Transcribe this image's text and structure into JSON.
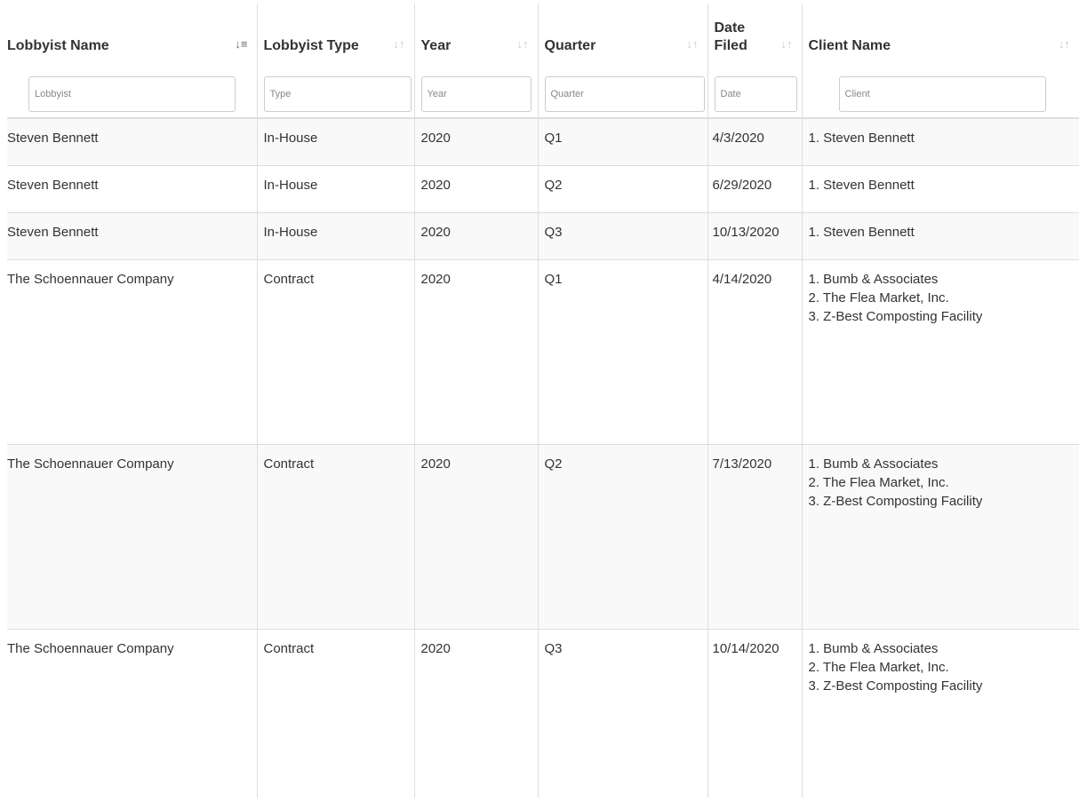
{
  "columns": [
    {
      "label": "Lobbyist Name",
      "filter_placeholder": "Lobbyist",
      "sort": "ascending"
    },
    {
      "label": "Lobbyist Type",
      "filter_placeholder": "Type",
      "sort": "none"
    },
    {
      "label": "Year",
      "filter_placeholder": "Year",
      "sort": "none"
    },
    {
      "label": "Quarter",
      "filter_placeholder": "Quarter",
      "sort": "none"
    },
    {
      "label_line1": "Date",
      "label_line2": "Filed",
      "filter_placeholder": "Date",
      "sort": "none"
    },
    {
      "label": "Client Name",
      "filter_placeholder": "Client",
      "sort": "none"
    }
  ],
  "sort_icons": {
    "active": "↓≡",
    "inactive": "↓↑"
  },
  "rows": [
    {
      "lobbyist": "Steven Bennett",
      "type": "In-House",
      "year": "2020",
      "quarter": "Q1",
      "date": "4/3/2020",
      "clients": [
        "1. Steven Bennett"
      ]
    },
    {
      "lobbyist": "Steven Bennett",
      "type": "In-House",
      "year": "2020",
      "quarter": "Q2",
      "date": "6/29/2020",
      "clients": [
        "1. Steven Bennett"
      ]
    },
    {
      "lobbyist": "Steven Bennett",
      "type": "In-House",
      "year": "2020",
      "quarter": "Q3",
      "date": "10/13/2020",
      "clients": [
        "1. Steven Bennett"
      ]
    },
    {
      "lobbyist": "The Schoennauer Company",
      "type": "Contract",
      "year": "2020",
      "quarter": "Q1",
      "date": "4/14/2020",
      "clients": [
        "1. Bumb & Associates",
        "2. The Flea Market, Inc.",
        "3. Z-Best Composting Facility"
      ]
    },
    {
      "lobbyist": "The Schoennauer Company",
      "type": "Contract",
      "year": "2020",
      "quarter": "Q2",
      "date": "7/13/2020",
      "clients": [
        "1. Bumb & Associates",
        "2. The Flea Market, Inc.",
        "3. Z-Best Composting Facility"
      ]
    },
    {
      "lobbyist": "The Schoennauer Company",
      "type": "Contract",
      "year": "2020",
      "quarter": "Q3",
      "date": "10/14/2020",
      "clients": [
        "1. Bumb & Associates",
        "2. The Flea Market, Inc.",
        "3. Z-Best Composting Facility"
      ]
    }
  ]
}
